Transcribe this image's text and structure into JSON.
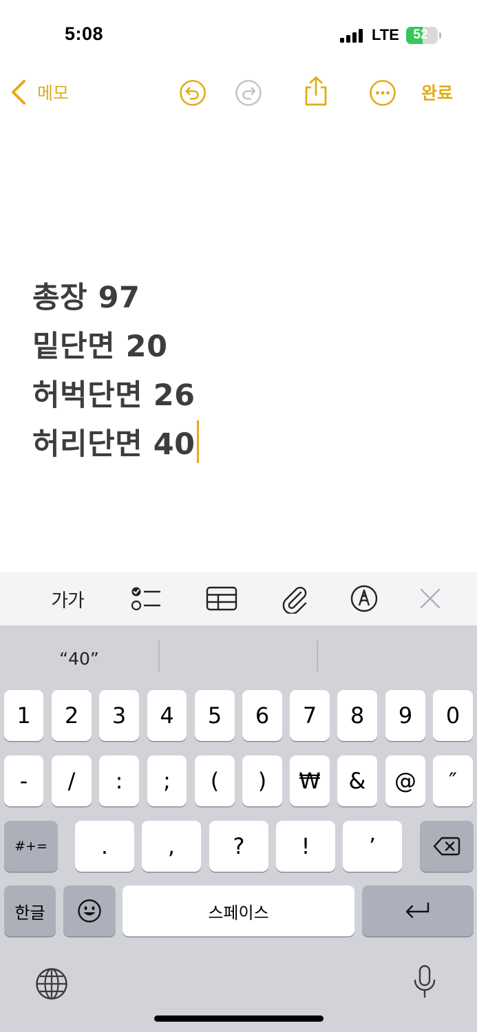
{
  "status_bar": {
    "time": "5:08",
    "network": "LTE",
    "battery_percent": "52",
    "battery_level": 0.52
  },
  "nav": {
    "back_label": "메모",
    "done_label": "완료"
  },
  "note": {
    "lines": [
      "총장 97",
      "밑단면 20",
      "허벅단면 26",
      "허리단면 40"
    ]
  },
  "toolbar": {
    "format_label": "가가"
  },
  "keyboard": {
    "prediction": "“40”",
    "row1": [
      "1",
      "2",
      "3",
      "4",
      "5",
      "6",
      "7",
      "8",
      "9",
      "0"
    ],
    "row2": [
      "-",
      "/",
      ":",
      ";",
      "(",
      ")",
      "₩",
      "&",
      "@",
      "″"
    ],
    "row3": [
      ".",
      ",",
      "?",
      "!",
      "’"
    ],
    "symbols_label": "#+=",
    "lang_label": "한글",
    "space_label": "스페이스"
  },
  "colors": {
    "accent": "#e3ab14",
    "note_text": "#3d3d3d",
    "keyboard_bg": "#d1d3d9",
    "key_bg": "#ffffff",
    "key_dark": "#abb0ba",
    "battery": "#37c759"
  }
}
